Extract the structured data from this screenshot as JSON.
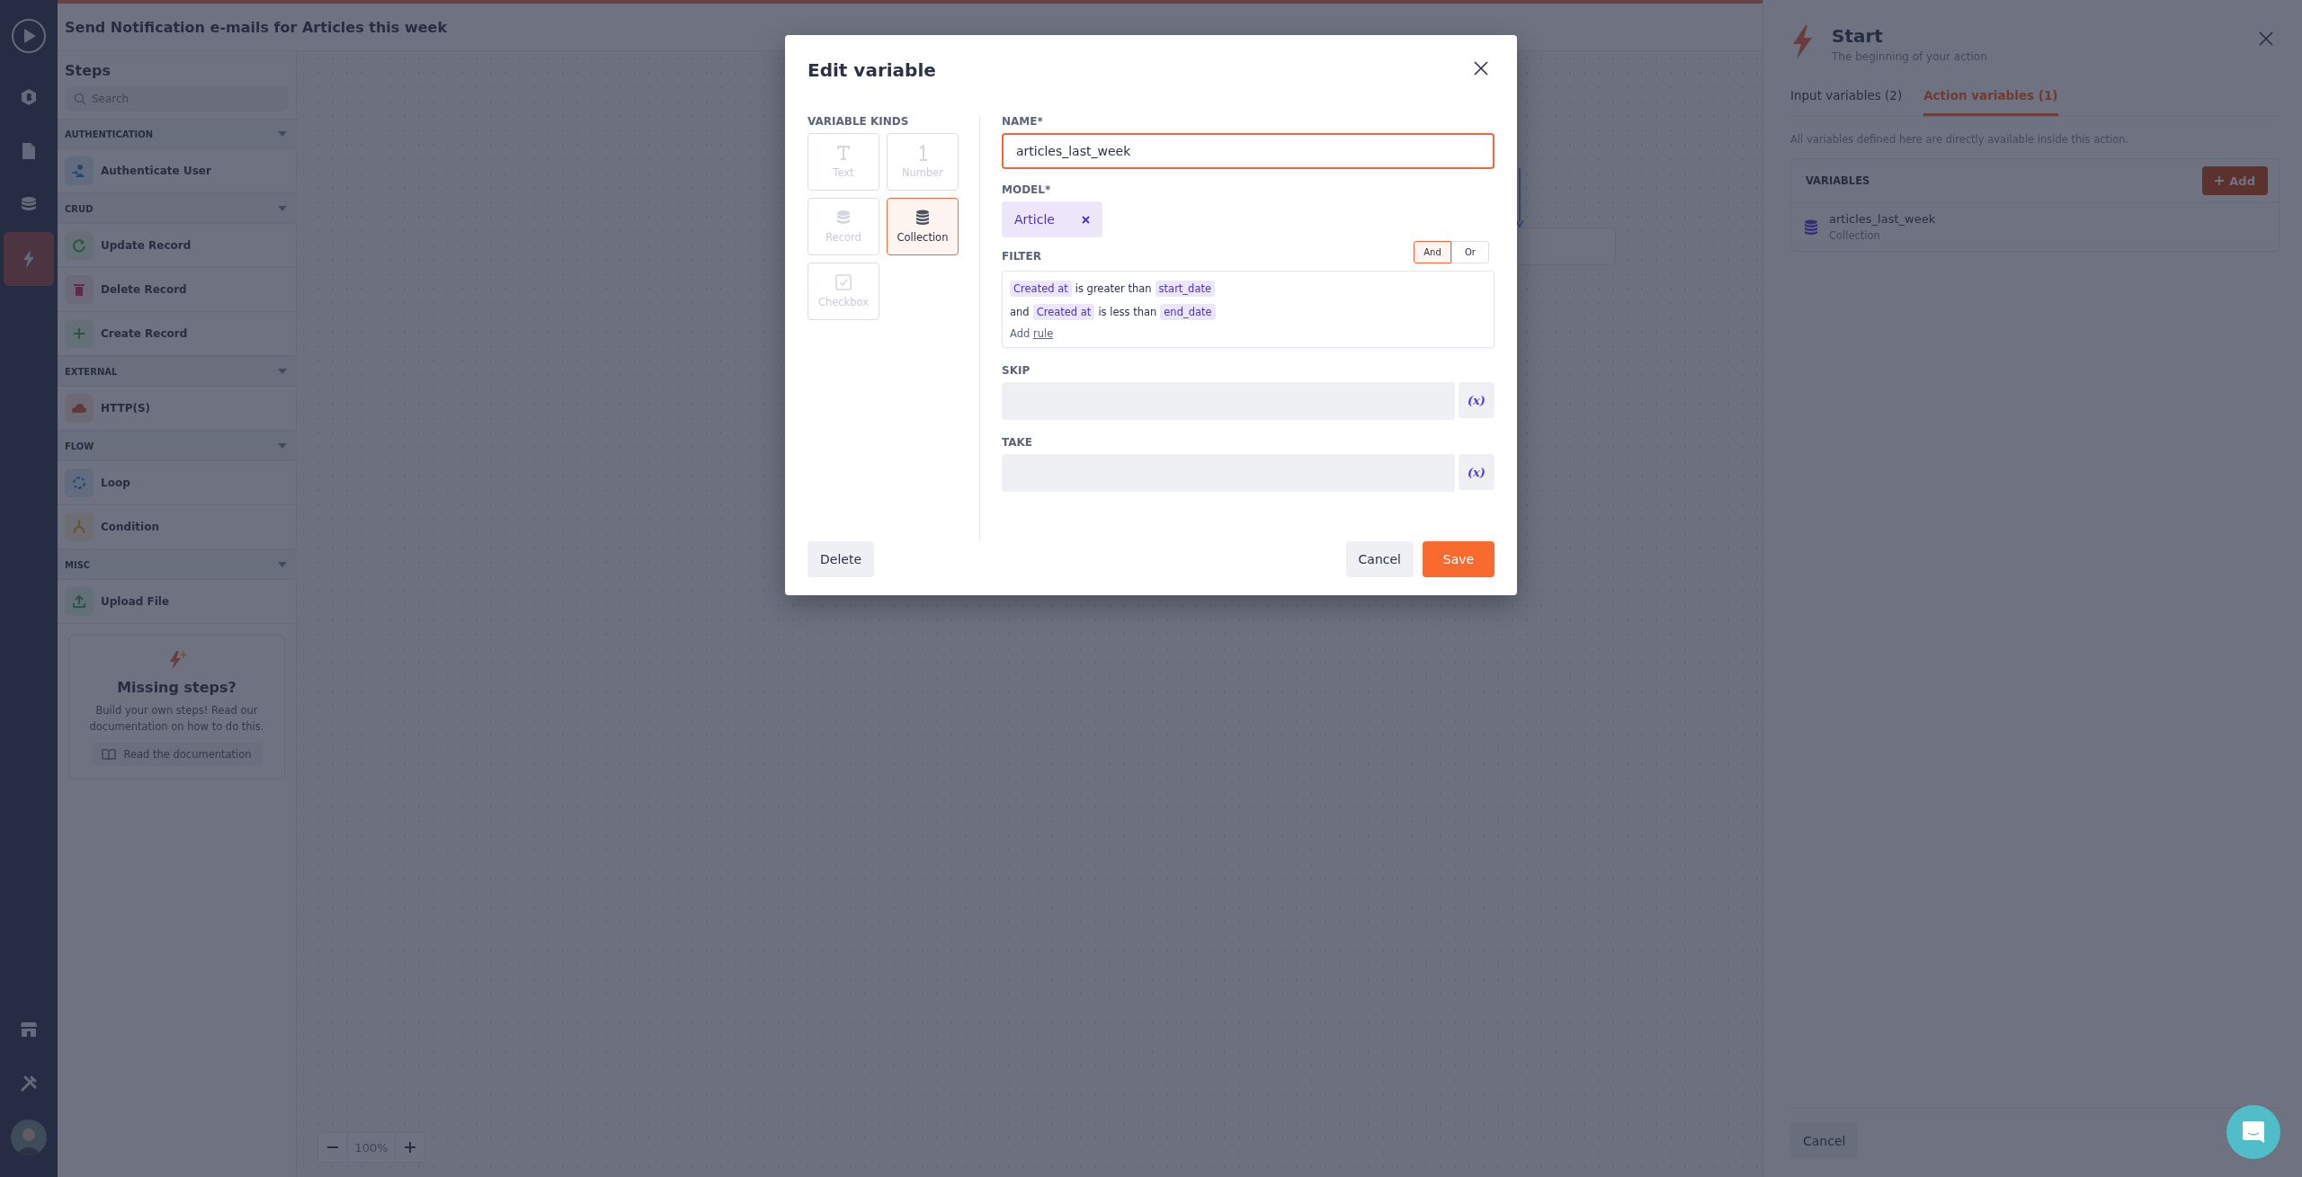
{
  "app": {
    "title": "Send Notification e-mails for Articles this week"
  },
  "rail": {
    "top": [
      {
        "kind": "play",
        "selected": false
      },
      {
        "kind": "logo",
        "selected": false
      },
      {
        "kind": "page",
        "selected": false
      },
      {
        "kind": "database",
        "selected": false
      },
      {
        "kind": "bolt",
        "selected": true
      }
    ],
    "bottom": [
      {
        "kind": "store",
        "selected": false
      },
      {
        "kind": "tools",
        "selected": false
      },
      {
        "kind": "avatar",
        "selected": false
      }
    ]
  },
  "steps": {
    "title": "Steps",
    "search": {
      "placeholder": "Search"
    },
    "groups": [
      {
        "name": "AUTHENTICATION",
        "expanded": true,
        "items": [
          {
            "label": "Authenticate User",
            "kind": "auth"
          }
        ]
      },
      {
        "name": "CRUD",
        "expanded": true,
        "items": [
          {
            "label": "Update Record",
            "kind": "update"
          },
          {
            "label": "Delete Record",
            "kind": "delete"
          },
          {
            "label": "Create Record",
            "kind": "create"
          }
        ]
      },
      {
        "name": "EXTERNAL",
        "expanded": true,
        "items": [
          {
            "label": "HTTP(S)",
            "kind": "http"
          }
        ]
      },
      {
        "name": "FLOW",
        "expanded": true,
        "items": [
          {
            "label": "Loop",
            "kind": "loop"
          },
          {
            "label": "Condition",
            "kind": "condition"
          }
        ]
      },
      {
        "name": "MISC",
        "expanded": true,
        "items": [
          {
            "label": "Upload File",
            "kind": "upload"
          }
        ]
      }
    ],
    "help": {
      "title": "Missing steps?",
      "text": "Build your own steps! Read our documentation on how to do this.",
      "button": "Read the documentation"
    }
  },
  "canvas": {
    "zoom": "100%"
  },
  "panel": {
    "title": "Start",
    "subtitle": "The beginning of your action",
    "tabs": [
      {
        "label": "Input variables (2)",
        "selected": false
      },
      {
        "label": "Action variables (1)",
        "selected": true
      }
    ],
    "description": "All variables defined here are directly available inside this action.",
    "variables": {
      "heading": "VARIABLES",
      "add": "Add",
      "items": [
        {
          "name": "articles_last_week",
          "type": "Collection"
        }
      ]
    },
    "cancel": "Cancel"
  },
  "modal": {
    "title": "Edit variable",
    "kinds_label": "VARIABLE KINDS",
    "kinds": [
      {
        "label": "Text",
        "kind": "text",
        "selected": false,
        "disabled": true
      },
      {
        "label": "Number",
        "kind": "number",
        "selected": false,
        "disabled": true
      },
      {
        "label": "Record",
        "kind": "record",
        "selected": false,
        "disabled": true
      },
      {
        "label": "Collection",
        "kind": "collection",
        "selected": true,
        "disabled": false
      },
      {
        "label": "Checkbox",
        "kind": "checkbox",
        "selected": false,
        "disabled": true
      }
    ],
    "name_label": "NAME*",
    "name_value": "articles_last_week",
    "model_label": "MODEL*",
    "model": "Article",
    "filter_label": "FILTER",
    "logic": [
      {
        "label": "And",
        "selected": true
      },
      {
        "label": "Or",
        "selected": false
      }
    ],
    "rules": [
      {
        "field": "Created at",
        "op": "is greater than",
        "value": "start_date"
      },
      {
        "prefix": "and",
        "field": "Created at",
        "op": "is less than",
        "value": "end_date"
      }
    ],
    "add_rule": {
      "text": "Add",
      "link": "rule"
    },
    "skip_label": "SKIP",
    "take_label": "TAKE",
    "var_buttons": [
      "(x)",
      "(x)"
    ],
    "delete": "Delete",
    "cancel": "Cancel",
    "save": "Save"
  }
}
